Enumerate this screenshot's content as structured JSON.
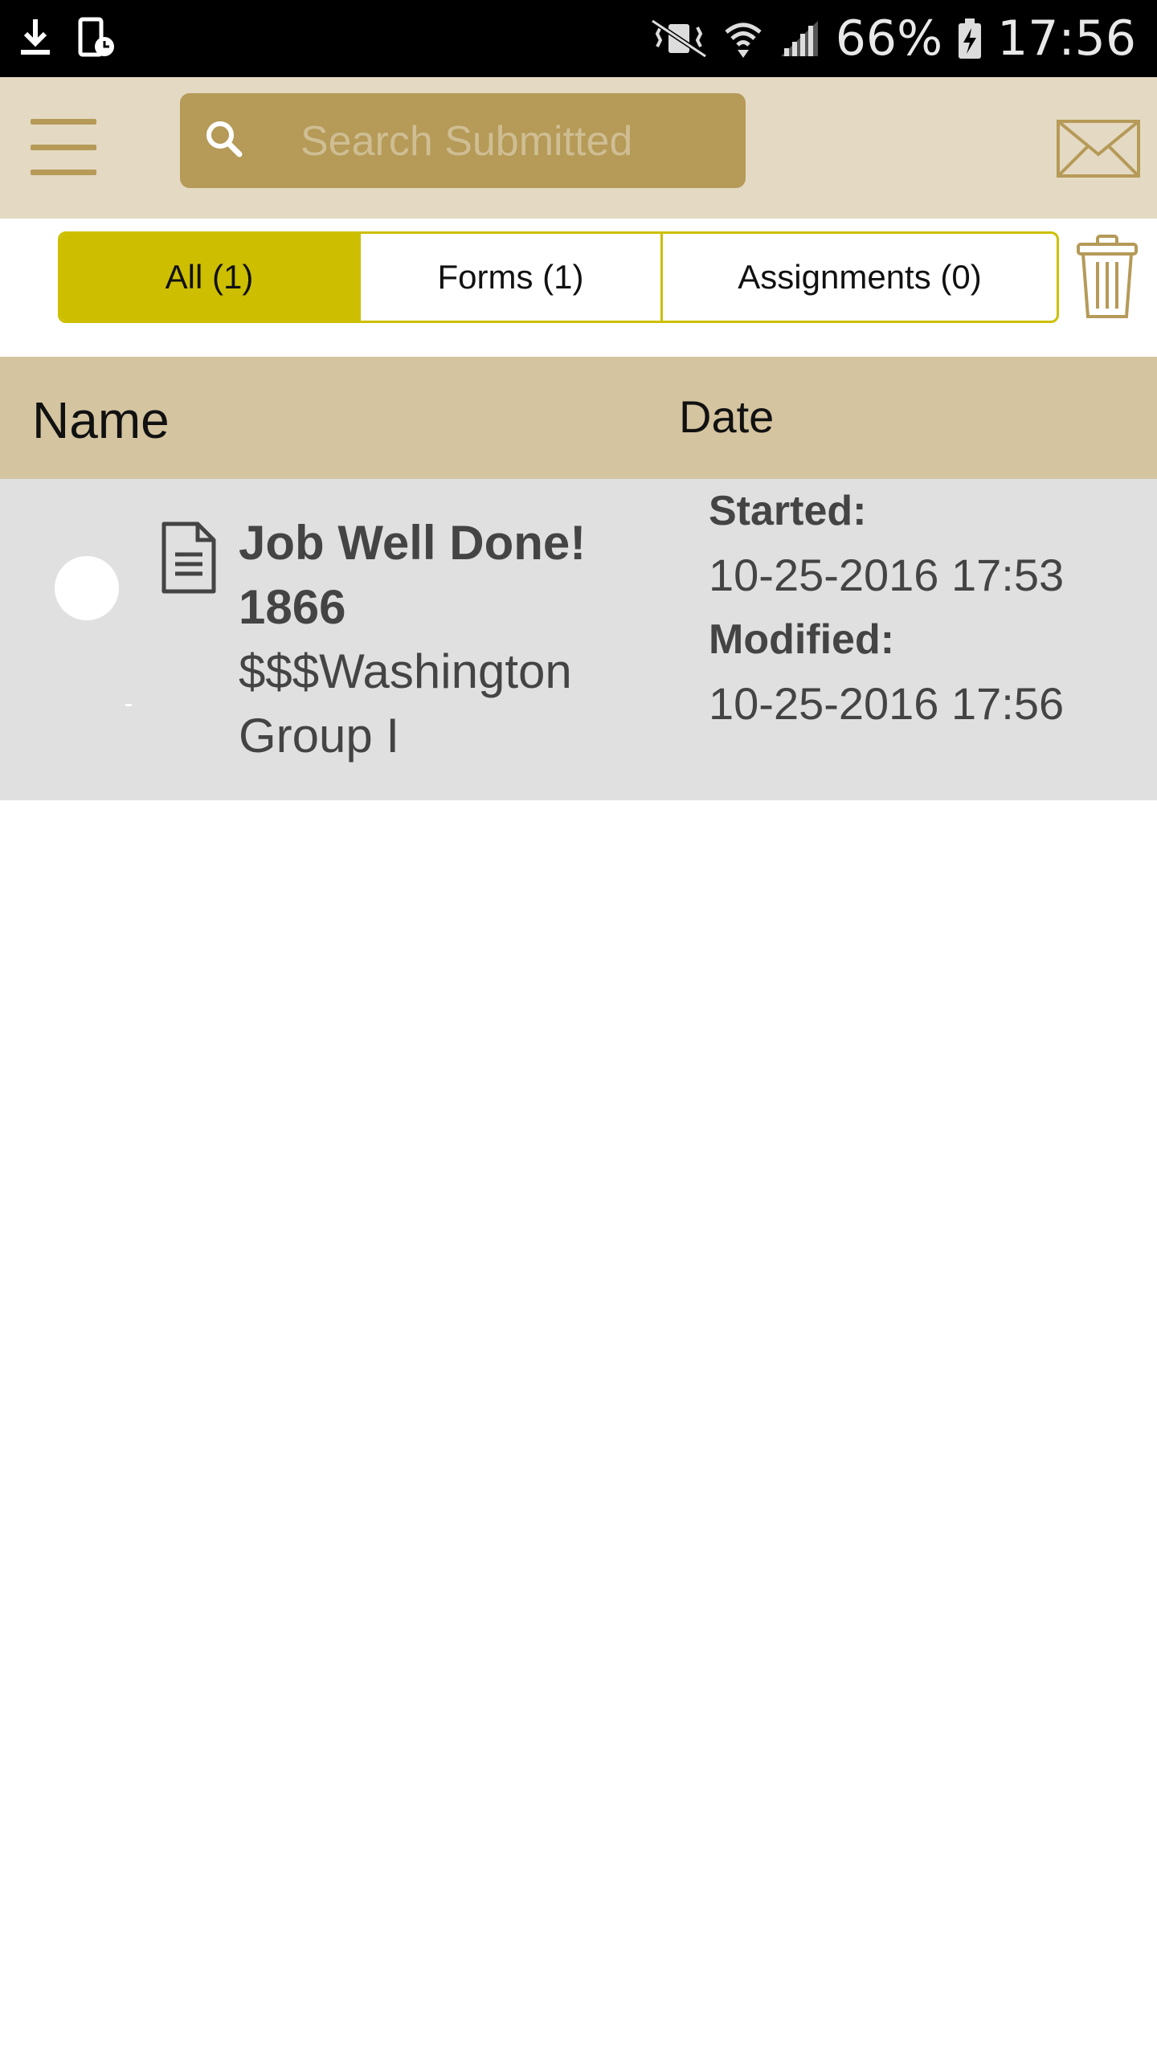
{
  "status_bar": {
    "battery": "66%",
    "time": "17:56"
  },
  "header": {
    "search": {
      "placeholder": "Search Submitted",
      "value": ""
    }
  },
  "filters": {
    "tabs": [
      {
        "label": "All (1)",
        "active": true
      },
      {
        "label": "Forms (1)",
        "active": false
      },
      {
        "label": "Assignments (0)",
        "active": false
      }
    ]
  },
  "table": {
    "columns": {
      "name": "Name",
      "date": "Date"
    },
    "rows": [
      {
        "title": "Job Well Done! 1866",
        "subtitle": "$$$Washington Group I",
        "started_label": "Started:",
        "started": "10-25-2016 17:53",
        "modified_label": "Modified:",
        "modified": "10-25-2016 17:56"
      }
    ]
  },
  "colors": {
    "app_bar": "#e4d9c2",
    "accent_gold": "#b59a58",
    "segment_active": "#cdbf00",
    "table_header": "#d4c4a0",
    "row_bg": "#e0e0e0"
  }
}
